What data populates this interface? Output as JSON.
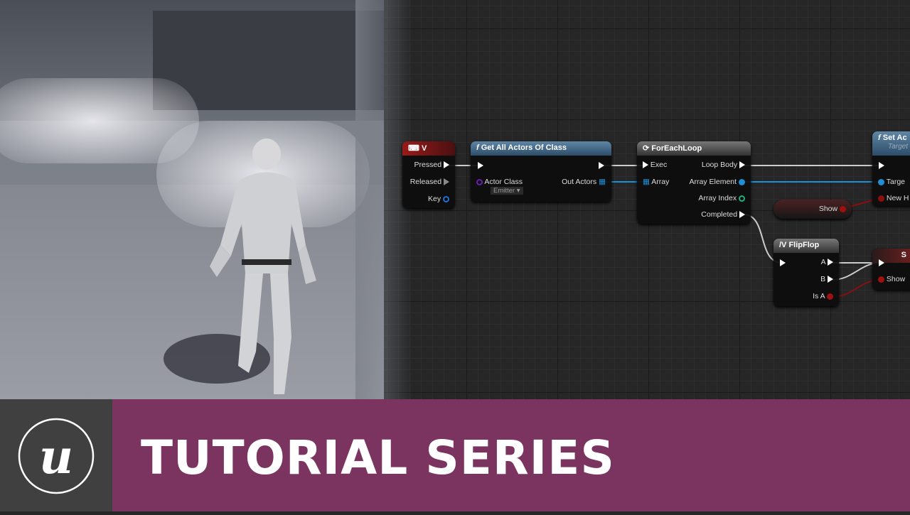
{
  "banner": {
    "title": "TUTORIAL SERIES",
    "logo": "Unreal Engine",
    "color": "#7b3460"
  },
  "nodes": {
    "input_key": {
      "title": "V",
      "pins": [
        "Pressed",
        "Released",
        "Key"
      ],
      "icon": "keyboard-icon"
    },
    "get_all_actors": {
      "title": "Get All Actors Of Class",
      "actor_class_label": "Actor Class",
      "actor_class_value": "Emitter",
      "out": "Out Actors",
      "icon": "function-icon"
    },
    "for_each": {
      "title": "ForEachLoop",
      "exec": "Exec",
      "array": "Array",
      "loop_body": "Loop Body",
      "array_element": "Array Element",
      "array_index": "Array Index",
      "completed": "Completed",
      "icon": "loop-icon"
    },
    "set_node": {
      "title": "Set Ac",
      "subtitle": "Target",
      "target": "Targe",
      "new": "New H"
    },
    "show_var": {
      "label": "Show"
    },
    "flipflop": {
      "title": "FlipFlop",
      "a": "A",
      "b": "B",
      "is_a": "Is A"
    },
    "set_show": {
      "title": "S",
      "pin": "Show"
    }
  }
}
